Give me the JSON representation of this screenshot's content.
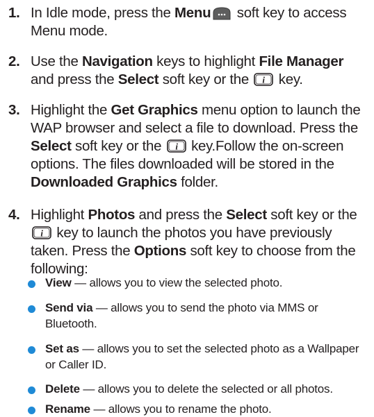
{
  "steps": [
    {
      "num": "1.",
      "p1": "In Idle mode, press the ",
      "b1": "Menu",
      "p2": " soft key to access Menu mode."
    },
    {
      "num": "2.",
      "p1": "Use the ",
      "b1": "Navigation",
      "p2": " keys to highlight ",
      "b2": "File Manager",
      "p3": " and press the ",
      "b3": "Select",
      "p4": " soft key or the ",
      "p5": " key."
    },
    {
      "num": "3.",
      "p1": "Highlight the ",
      "b1": "Get Graphics",
      "p2": " menu option to launch the WAP browser and select a file to download. Press the ",
      "b2": "Select",
      "p3": " soft key or the ",
      "p4": " key.Follow the on-screen options. The files downloaded will be stored in the ",
      "b3": "Downloaded Graphics",
      "p5": " folder."
    },
    {
      "num": "4.",
      "p1": "Highlight ",
      "b1": "Photos",
      "p2": " and press the ",
      "b2": "Select",
      "p3": " soft key or the ",
      "p4": " key to launch the photos you have previously taken. Press the ",
      "b3": "Options",
      "p5": " soft key to choose from the following:"
    }
  ],
  "options": [
    {
      "term": "View",
      "desc": " — allows you to view the selected photo."
    },
    {
      "term": "Send via",
      "desc": " — allows you to send the photo via MMS or Bluetooth."
    },
    {
      "term": "Set as",
      "desc": " — allows you to set the selected photo as a Wallpaper or Caller ID."
    },
    {
      "term": "Delete",
      "desc": " — allows you to delete the selected or all photos."
    },
    {
      "term": "Rename",
      "desc": " — allows you to rename the photo."
    }
  ],
  "icons": {
    "menu_key": "menu-softkey-icon",
    "info_key": "i-key-icon",
    "bullet_color": "#1f8ad6"
  }
}
